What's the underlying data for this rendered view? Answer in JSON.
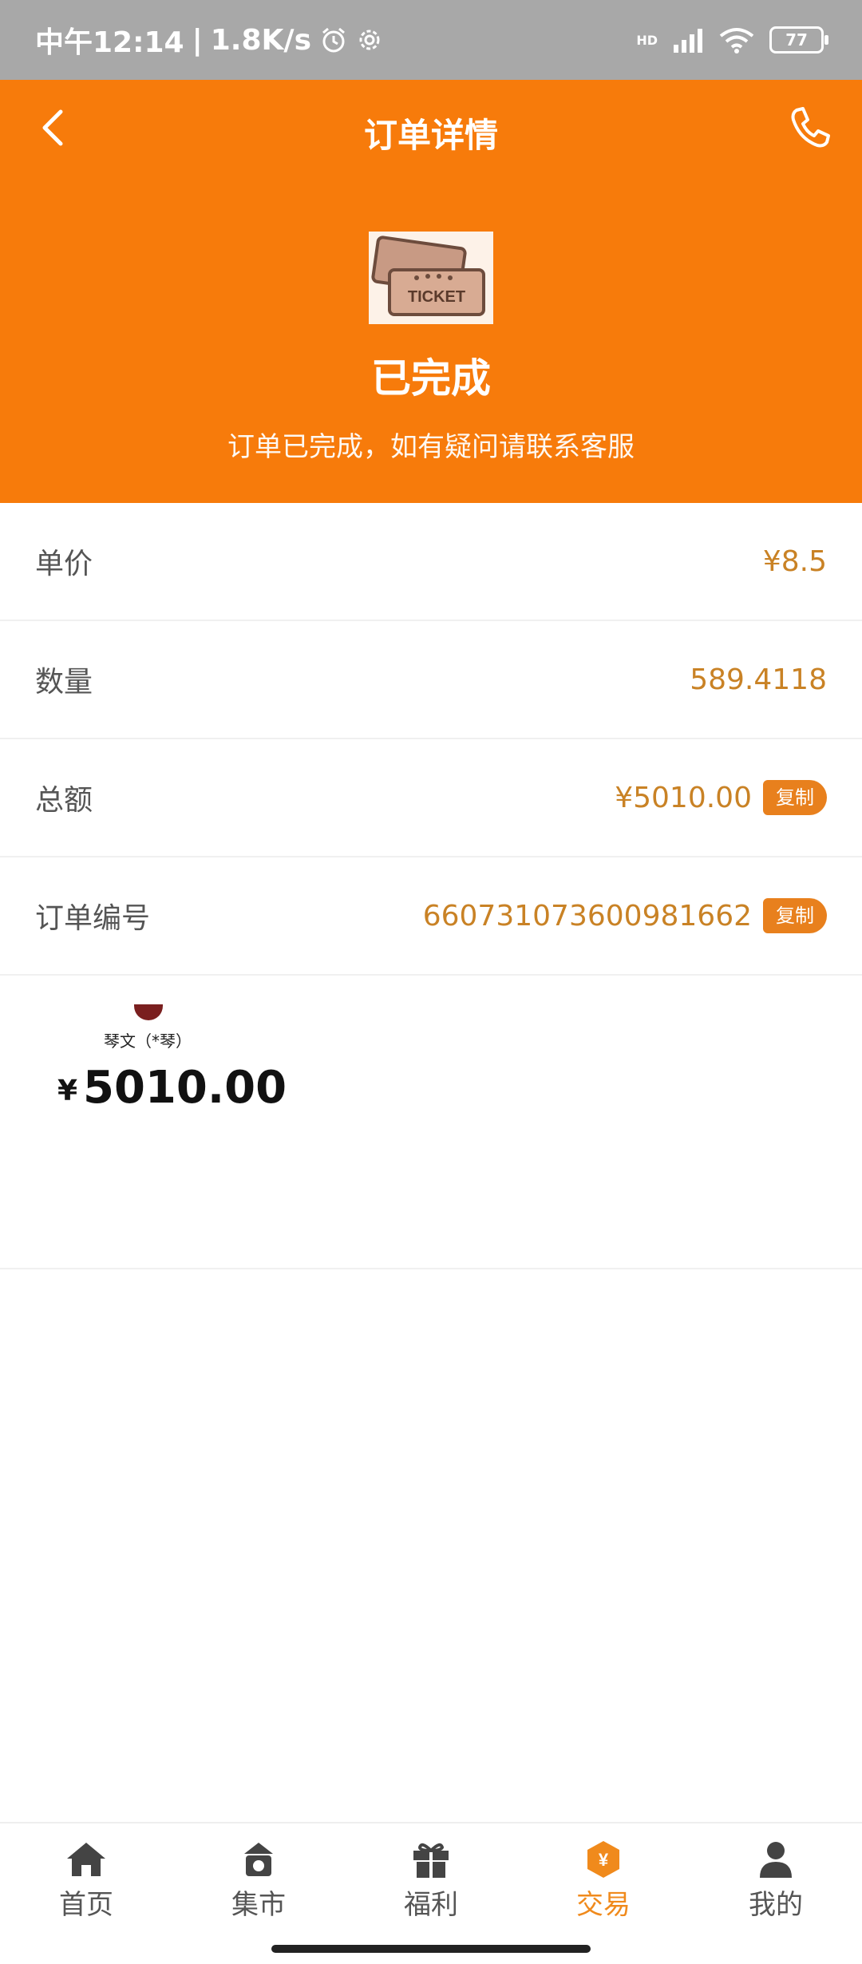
{
  "status_bar": {
    "time": "中午12:14",
    "speed": "1.8K/s",
    "network": "HD",
    "battery": "77"
  },
  "header": {
    "title": "订单详情",
    "ticket_text": "TICKET",
    "status": "已完成",
    "subtitle": "订单已完成，如有疑问请联系客服"
  },
  "details": [
    {
      "label": "单价",
      "value": "¥8.5"
    },
    {
      "label": "数量",
      "value": "589.4118"
    },
    {
      "label": "总额",
      "value": "¥5010.00",
      "copy": "复制"
    },
    {
      "label": "订单编号",
      "value": "660731073600981662",
      "copy": "复制"
    }
  ],
  "payment": {
    "payee": "琴文（*琴）",
    "currency": "¥",
    "amount": "5010.00"
  },
  "nav": {
    "items": [
      {
        "label": "首页",
        "icon": "home-icon"
      },
      {
        "label": "集市",
        "icon": "market-icon"
      },
      {
        "label": "福利",
        "icon": "gift-icon"
      },
      {
        "label": "交易",
        "icon": "trade-icon",
        "active": true
      },
      {
        "label": "我的",
        "icon": "profile-icon"
      }
    ],
    "active_color": "#f08a1c"
  },
  "colors": {
    "header": "#f77b0b",
    "value": "#c98225",
    "copy_button": "#e8801d"
  }
}
